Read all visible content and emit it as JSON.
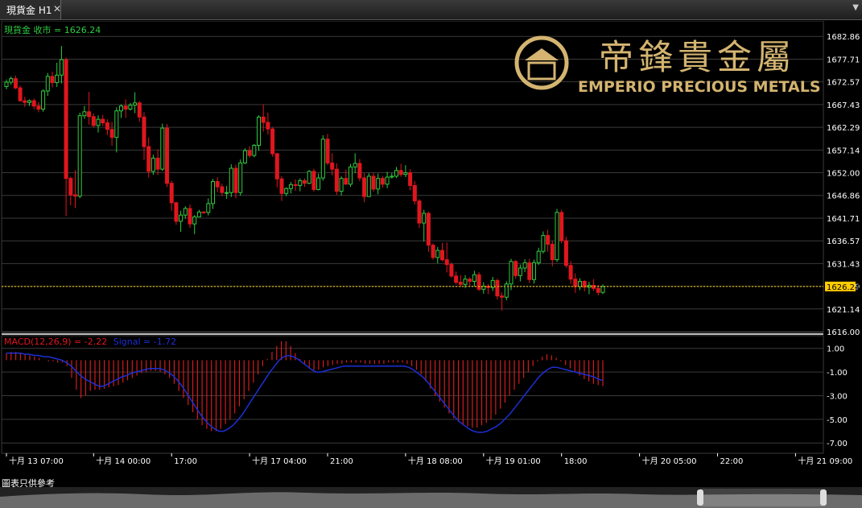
{
  "window": {
    "tab_label": "現貨金 H1",
    "close_glyph": "✕",
    "menu_glyph": "▼"
  },
  "brand": {
    "chinese_name": "帝鋒貴金屬",
    "english_name": "EMPERIO PRECIOUS METALS"
  },
  "colors": {
    "background": "#000000",
    "up_candle": "#2ecc40",
    "down_candle": "#e0161e",
    "macd_hist": "#d41c1c",
    "signal_line": "#1c2fd4",
    "gold": "#d4b470",
    "price_line": "#ffcc00",
    "grid": "#3a3a3a"
  },
  "footer": {
    "note": "圖表只供參考"
  },
  "chart_data": [
    {
      "type": "candlestick",
      "title": "現貨金 收市 = 1626.24",
      "last_price": 1626.24,
      "last_price_label": "1626.24",
      "ylim": [
        1616.0,
        1686.0
      ],
      "yticks": [
        "1682.86",
        "1677.71",
        "1672.57",
        "1667.43",
        "1662.29",
        "1657.14",
        "1652.00",
        "1646.86",
        "1641.71",
        "1636.57",
        "1631.43",
        "1626.29",
        "1621.14",
        "1616.00"
      ],
      "ytick_values": [
        1682.86,
        1677.71,
        1672.57,
        1667.43,
        1662.29,
        1657.14,
        1652.0,
        1646.86,
        1641.71,
        1636.57,
        1631.43,
        1626.29,
        1621.14,
        1616.0
      ],
      "xticks": [
        "十月 13 07:00",
        "十月 14 00:00",
        "17:00",
        "十月 17 04:00",
        "21:00",
        "十月 18 08:00",
        "十月 19 01:00",
        "18:00",
        "十月 20 05:00",
        "22:00",
        "十月 21 09:00"
      ],
      "xtick_index": [
        0,
        19,
        36,
        53,
        70,
        87,
        104,
        121,
        138,
        155,
        172
      ],
      "candles": [
        [
          1671.5,
          1673.1,
          1670.9,
          1672.5
        ],
        [
          1672.5,
          1673.8,
          1671.9,
          1673.3
        ],
        [
          1673.3,
          1674.0,
          1670.9,
          1671.2
        ],
        [
          1671.2,
          1671.7,
          1668.1,
          1668.3
        ],
        [
          1668.3,
          1669.2,
          1666.9,
          1667.9
        ],
        [
          1667.9,
          1668.6,
          1667.1,
          1668.3
        ],
        [
          1668.3,
          1668.8,
          1666.4,
          1667.1
        ],
        [
          1667.1,
          1668.0,
          1665.7,
          1666.4
        ],
        [
          1666.4,
          1670.9,
          1665.8,
          1670.5
        ],
        [
          1670.5,
          1674.6,
          1669.4,
          1673.8
        ],
        [
          1673.8,
          1674.9,
          1671.3,
          1672.4
        ],
        [
          1672.4,
          1676.9,
          1671.4,
          1674.1
        ],
        [
          1674.1,
          1680.7,
          1672.2,
          1677.6
        ],
        [
          1677.6,
          1678.1,
          1642.2,
          1650.7
        ],
        [
          1650.7,
          1651.1,
          1644.6,
          1647.0
        ],
        [
          1647.0,
          1652.6,
          1644.0,
          1646.7
        ],
        [
          1646.7,
          1665.6,
          1646.2,
          1664.9
        ],
        [
          1664.9,
          1667.1,
          1664.2,
          1665.8
        ],
        [
          1665.8,
          1670.3,
          1662.9,
          1664.7
        ],
        [
          1664.7,
          1665.4,
          1662.2,
          1662.7
        ],
        [
          1662.7,
          1665.0,
          1661.1,
          1664.1
        ],
        [
          1664.1,
          1665.1,
          1662.6,
          1663.3
        ],
        [
          1663.3,
          1664.1,
          1660.5,
          1661.8
        ],
        [
          1661.8,
          1663.5,
          1658.1,
          1660.0
        ],
        [
          1660.0,
          1666.8,
          1656.6,
          1666.0
        ],
        [
          1666.0,
          1667.5,
          1664.4,
          1667.1
        ],
        [
          1667.1,
          1668.6,
          1664.4,
          1666.4
        ],
        [
          1666.4,
          1667.8,
          1666.1,
          1667.3
        ],
        [
          1667.3,
          1670.2,
          1665.5,
          1667.8
        ],
        [
          1667.8,
          1668.2,
          1663.6,
          1664.6
        ],
        [
          1664.6,
          1665.7,
          1654.9,
          1657.9
        ],
        [
          1657.9,
          1660.0,
          1650.9,
          1652.3
        ],
        [
          1652.3,
          1656.1,
          1651.5,
          1655.3
        ],
        [
          1655.3,
          1657.3,
          1651.5,
          1652.8
        ],
        [
          1652.8,
          1663.1,
          1652.4,
          1662.1
        ],
        [
          1662.1,
          1663.0,
          1648.8,
          1649.6
        ],
        [
          1649.6,
          1650.2,
          1643.4,
          1645.2
        ],
        [
          1645.2,
          1645.4,
          1640.2,
          1641.0
        ],
        [
          1641.0,
          1643.4,
          1638.6,
          1642.4
        ],
        [
          1642.4,
          1644.4,
          1641.6,
          1643.9
        ],
        [
          1643.9,
          1644.8,
          1639.5,
          1640.4
        ],
        [
          1640.4,
          1642.4,
          1638.1,
          1642.0
        ],
        [
          1642.0,
          1643.6,
          1642.0,
          1643.1
        ],
        [
          1643.1,
          1643.3,
          1642.7,
          1643.0
        ],
        [
          1643.0,
          1646.2,
          1642.3,
          1645.0
        ],
        [
          1645.0,
          1650.6,
          1643.8,
          1650.0
        ],
        [
          1650.0,
          1651.0,
          1647.6,
          1648.8
        ],
        [
          1648.8,
          1649.5,
          1646.7,
          1647.5
        ],
        [
          1647.5,
          1649.0,
          1646.1,
          1647.5
        ],
        [
          1647.5,
          1653.9,
          1646.5,
          1653.0
        ],
        [
          1653.0,
          1653.8,
          1646.2,
          1647.5
        ],
        [
          1647.5,
          1655.0,
          1646.8,
          1654.2
        ],
        [
          1654.2,
          1657.5,
          1654.0,
          1657.0
        ],
        [
          1657.0,
          1658.0,
          1655.4,
          1655.9
        ],
        [
          1655.9,
          1658.5,
          1655.5,
          1658.2
        ],
        [
          1658.2,
          1665.0,
          1657.0,
          1664.6
        ],
        [
          1664.6,
          1667.5,
          1661.3,
          1663.4
        ],
        [
          1663.4,
          1665.6,
          1660.7,
          1661.9
        ],
        [
          1661.9,
          1662.3,
          1655.6,
          1656.3
        ],
        [
          1656.3,
          1656.5,
          1648.7,
          1650.6
        ],
        [
          1650.6,
          1651.2,
          1645.6,
          1647.3
        ],
        [
          1647.3,
          1648.7,
          1646.7,
          1648.4
        ],
        [
          1648.4,
          1649.9,
          1647.3,
          1649.3
        ],
        [
          1649.3,
          1650.5,
          1647.9,
          1649.1
        ],
        [
          1649.1,
          1650.7,
          1647.8,
          1650.2
        ],
        [
          1650.2,
          1650.7,
          1648.8,
          1649.6
        ],
        [
          1649.6,
          1652.6,
          1649.4,
          1652.3
        ],
        [
          1652.3,
          1652.9,
          1647.7,
          1648.2
        ],
        [
          1648.2,
          1651.8,
          1648.0,
          1650.8
        ],
        [
          1650.8,
          1660.5,
          1650.2,
          1659.6
        ],
        [
          1659.6,
          1660.8,
          1653.7,
          1654.2
        ],
        [
          1654.2,
          1656.4,
          1651.4,
          1652.8
        ],
        [
          1652.8,
          1654.1,
          1647.0,
          1647.8
        ],
        [
          1647.8,
          1651.2,
          1646.8,
          1650.7
        ],
        [
          1650.7,
          1652.7,
          1649.3,
          1649.4
        ],
        [
          1649.4,
          1654.0,
          1648.8,
          1653.3
        ],
        [
          1653.3,
          1656.4,
          1651.9,
          1654.1
        ],
        [
          1654.1,
          1655.1,
          1650.1,
          1650.8
        ],
        [
          1650.8,
          1651.9,
          1645.3,
          1646.6
        ],
        [
          1646.6,
          1651.9,
          1646.5,
          1651.2
        ],
        [
          1651.2,
          1652.0,
          1647.7,
          1648.3
        ],
        [
          1648.3,
          1651.8,
          1647.1,
          1650.7
        ],
        [
          1650.7,
          1651.3,
          1648.6,
          1649.4
        ],
        [
          1649.4,
          1652.2,
          1648.5,
          1651.0
        ],
        [
          1651.0,
          1651.9,
          1650.7,
          1651.2
        ],
        [
          1651.2,
          1653.3,
          1650.8,
          1652.5
        ],
        [
          1652.5,
          1654.0,
          1651.1,
          1651.6
        ],
        [
          1651.6,
          1653.7,
          1651.0,
          1652.0
        ],
        [
          1652.0,
          1652.8,
          1648.0,
          1649.1
        ],
        [
          1649.1,
          1650.1,
          1644.8,
          1645.6
        ],
        [
          1645.6,
          1646.0,
          1639.5,
          1640.6
        ],
        [
          1640.6,
          1643.6,
          1636.4,
          1642.8
        ],
        [
          1642.8,
          1643.2,
          1634.1,
          1635.6
        ],
        [
          1635.6,
          1636.0,
          1632.3,
          1632.8
        ],
        [
          1632.8,
          1635.2,
          1631.5,
          1634.4
        ],
        [
          1634.4,
          1636.1,
          1631.9,
          1632.3
        ],
        [
          1632.3,
          1636.2,
          1629.4,
          1631.2
        ],
        [
          1631.2,
          1631.7,
          1628.2,
          1628.6
        ],
        [
          1628.6,
          1629.6,
          1626.7,
          1627.2
        ],
        [
          1627.2,
          1628.8,
          1626.1,
          1626.7
        ],
        [
          1626.7,
          1628.8,
          1625.9,
          1627.9
        ],
        [
          1627.9,
          1628.3,
          1626.4,
          1627.4
        ],
        [
          1627.4,
          1629.8,
          1626.2,
          1628.9
        ],
        [
          1628.9,
          1629.5,
          1625.2,
          1625.6
        ],
        [
          1625.6,
          1627.2,
          1624.6,
          1626.3
        ],
        [
          1626.3,
          1626.8,
          1624.5,
          1626.0
        ],
        [
          1626.0,
          1628.4,
          1625.2,
          1627.6
        ],
        [
          1627.6,
          1628.0,
          1623.3,
          1624.1
        ],
        [
          1624.1,
          1624.9,
          1620.8,
          1623.8
        ],
        [
          1623.8,
          1627.4,
          1623.1,
          1626.8
        ],
        [
          1626.8,
          1632.5,
          1625.4,
          1631.9
        ],
        [
          1631.9,
          1632.2,
          1628.0,
          1628.7
        ],
        [
          1628.7,
          1631.2,
          1627.4,
          1630.4
        ],
        [
          1630.4,
          1632.4,
          1629.5,
          1631.6
        ],
        [
          1631.6,
          1632.5,
          1627.0,
          1627.8
        ],
        [
          1627.8,
          1632.3,
          1626.9,
          1631.6
        ],
        [
          1631.6,
          1635.0,
          1631.1,
          1634.2
        ],
        [
          1634.2,
          1638.7,
          1633.7,
          1637.8
        ],
        [
          1637.8,
          1639.1,
          1634.1,
          1635.8
        ],
        [
          1635.8,
          1636.6,
          1630.8,
          1632.3
        ],
        [
          1632.3,
          1643.8,
          1631.8,
          1643.0
        ],
        [
          1643.0,
          1643.6,
          1636.0,
          1636.6
        ],
        [
          1636.6,
          1637.5,
          1630.5,
          1631.0
        ],
        [
          1631.0,
          1632.0,
          1626.8,
          1627.9
        ],
        [
          1627.9,
          1629.2,
          1624.8,
          1626.2
        ],
        [
          1626.2,
          1628.1,
          1625.4,
          1627.4
        ],
        [
          1627.4,
          1627.7,
          1625.1,
          1626.1
        ],
        [
          1626.1,
          1627.3,
          1624.5,
          1626.5
        ],
        [
          1626.5,
          1627.9,
          1625.2,
          1625.8
        ],
        [
          1625.8,
          1626.6,
          1624.2,
          1624.9
        ],
        [
          1624.9,
          1626.7,
          1624.5,
          1626.24
        ]
      ],
      "candle_span": [
        0,
        172
      ]
    },
    {
      "type": "macd",
      "title": "MACD(12,26,9) = -2.22",
      "signal_label": "Signal = -1.72",
      "ylim": [
        -7.8,
        2.0
      ],
      "yticks": [
        "1.00",
        "-1.00",
        "-3.00",
        "-5.00",
        "-7.00"
      ],
      "ytick_values": [
        1.0,
        -1.0,
        -3.0,
        -5.0,
        -7.0
      ],
      "histogram": [
        0.6,
        0.7,
        0.7,
        0.6,
        0.5,
        0.4,
        0.3,
        0.2,
        0.0,
        -0.1,
        -0.1,
        -0.2,
        -0.2,
        -0.5,
        -1.5,
        -2.5,
        -3.2,
        -3.0,
        -2.6,
        -2.5,
        -2.5,
        -2.4,
        -2.3,
        -2.2,
        -2.1,
        -1.9,
        -1.7,
        -1.5,
        -1.3,
        -1.1,
        -1.0,
        -0.9,
        -0.9,
        -1.0,
        -1.2,
        -1.5,
        -2.0,
        -2.6,
        -3.2,
        -3.8,
        -4.4,
        -5.0,
        -5.5,
        -5.8,
        -6.0,
        -6.0,
        -5.8,
        -5.4,
        -5.0,
        -4.5,
        -3.9,
        -3.3,
        -2.6,
        -1.9,
        -1.2,
        -0.5,
        0.1,
        0.7,
        1.2,
        1.6,
        1.6,
        1.2,
        0.6,
        0.1,
        -0.4,
        -0.7,
        -0.8,
        -0.8,
        -0.6,
        -0.5,
        -0.4,
        -0.3,
        -0.3,
        -0.2,
        -0.2,
        -0.2,
        -0.2,
        -0.3,
        -0.3,
        -0.3,
        -0.3,
        -0.3,
        -0.2,
        -0.2,
        -0.2,
        -0.2,
        -0.3,
        -0.5,
        -0.8,
        -1.2,
        -1.8,
        -2.4,
        -3.0,
        -3.5,
        -4.0,
        -4.5,
        -4.9,
        -5.2,
        -5.5,
        -5.6,
        -5.7,
        -5.7,
        -5.5,
        -5.3,
        -5.0,
        -4.6,
        -4.1,
        -3.6,
        -3.0,
        -2.5,
        -2.0,
        -1.5,
        -1.0,
        -0.5,
        -0.1,
        0.3,
        0.5,
        0.4,
        0.2,
        -0.1,
        -0.4,
        -0.7,
        -1.0,
        -1.3,
        -1.6,
        -1.8,
        -2.0,
        -2.1,
        -2.2
      ],
      "signal": [
        0.6,
        0.6,
        0.6,
        0.6,
        0.5,
        0.5,
        0.4,
        0.4,
        0.3,
        0.3,
        0.2,
        0.1,
        0.0,
        -0.2,
        -0.5,
        -0.9,
        -1.3,
        -1.6,
        -1.8,
        -2.0,
        -2.2,
        -2.2,
        -2.0,
        -1.8,
        -1.6,
        -1.4,
        -1.3,
        -1.1,
        -1.0,
        -0.9,
        -0.8,
        -0.7,
        -0.7,
        -0.7,
        -0.8,
        -1.0,
        -1.3,
        -1.7,
        -2.2,
        -2.8,
        -3.4,
        -4.0,
        -4.6,
        -5.1,
        -5.5,
        -5.8,
        -6.0,
        -6.0,
        -5.8,
        -5.5,
        -5.1,
        -4.6,
        -4.0,
        -3.4,
        -2.8,
        -2.2,
        -1.6,
        -1.0,
        -0.5,
        0.0,
        0.3,
        0.4,
        0.3,
        0.1,
        -0.2,
        -0.5,
        -0.8,
        -1.0,
        -1.0,
        -0.9,
        -0.8,
        -0.7,
        -0.6,
        -0.5,
        -0.5,
        -0.5,
        -0.5,
        -0.5,
        -0.5,
        -0.5,
        -0.5,
        -0.5,
        -0.5,
        -0.5,
        -0.5,
        -0.5,
        -0.5,
        -0.6,
        -0.8,
        -1.1,
        -1.4,
        -1.8,
        -2.3,
        -2.8,
        -3.3,
        -3.8,
        -4.3,
        -4.8,
        -5.2,
        -5.5,
        -5.8,
        -6.0,
        -6.1,
        -6.1,
        -6.0,
        -5.8,
        -5.6,
        -5.3,
        -4.9,
        -4.5,
        -4.0,
        -3.5,
        -3.0,
        -2.5,
        -2.0,
        -1.5,
        -1.1,
        -0.8,
        -0.6,
        -0.6,
        -0.7,
        -0.8,
        -0.9,
        -1.0,
        -1.1,
        -1.2,
        -1.3,
        -1.4,
        -1.6,
        -1.72
      ]
    }
  ]
}
